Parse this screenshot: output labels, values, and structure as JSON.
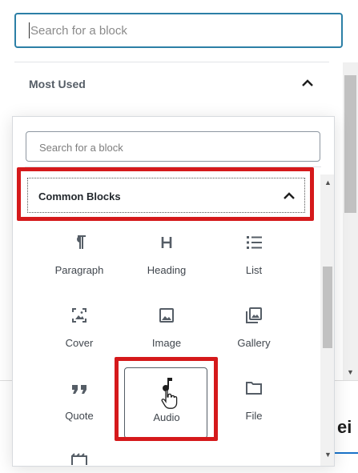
{
  "outer_inserter": {
    "search_placeholder": "Search for a block",
    "section_title": "Most Used",
    "right_cut_text": "ei"
  },
  "popover": {
    "search_placeholder": "Search for a block",
    "panel_title": "Common Blocks",
    "blocks": [
      {
        "label": "Paragraph",
        "icon": "paragraph-icon"
      },
      {
        "label": "Heading",
        "icon": "heading-icon"
      },
      {
        "label": "List",
        "icon": "list-icon"
      },
      {
        "label": "Cover",
        "icon": "cover-icon"
      },
      {
        "label": "Image",
        "icon": "image-icon"
      },
      {
        "label": "Gallery",
        "icon": "gallery-icon"
      },
      {
        "label": "Quote",
        "icon": "quote-icon"
      },
      {
        "label": "Audio",
        "icon": "audio-icon",
        "hovered": true
      },
      {
        "label": "File",
        "icon": "file-icon"
      },
      {
        "label": "",
        "icon": "video-icon"
      }
    ]
  },
  "colors": {
    "highlight_red": "#d5191b",
    "focus_blue": "#2c7fa6",
    "icon_dark": "#555d66"
  }
}
